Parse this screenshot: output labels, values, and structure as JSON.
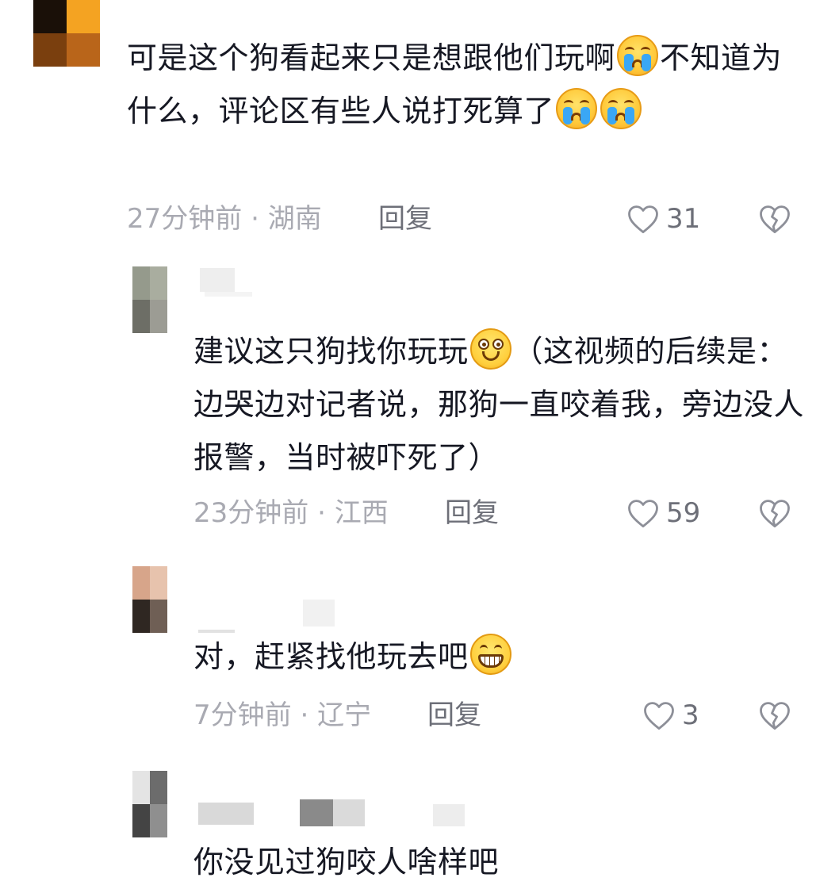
{
  "comments": [
    {
      "segments": [
        {
          "type": "text",
          "value": "可是这个狗看起来只是想跟他们玩啊"
        },
        {
          "type": "emoji",
          "name": "crying-emoji"
        },
        {
          "type": "text",
          "value": "不知道为什么，评论区有些人说打死算了"
        },
        {
          "type": "emoji",
          "name": "crying-emoji"
        },
        {
          "type": "emoji",
          "name": "crying-emoji"
        }
      ],
      "time": "27分钟前",
      "separator": " · ",
      "location": "湖南",
      "reply_label": "回复",
      "like_count": "31",
      "avatar_colors": [
        "#1a1008",
        "#f4a322",
        "#7a3f0e",
        "#b9651a"
      ]
    },
    {
      "segments": [
        {
          "type": "text",
          "value": "建议这只狗找你玩玩"
        },
        {
          "type": "emoji",
          "name": "smile-emoji"
        },
        {
          "type": "text",
          "value": "（这视频的后续是：边哭边对记者说，那狗一直咬着我，旁边没人报警，当时被吓死了）"
        }
      ],
      "time": "23分钟前",
      "separator": " · ",
      "location": "江西",
      "reply_label": "回复",
      "like_count": "59",
      "avatar_colors": [
        "#959a8c",
        "#a9ad9f",
        "#6d6e66",
        "#9c9c94"
      ]
    },
    {
      "segments": [
        {
          "type": "text",
          "value": "对，赶紧找他玩去吧"
        },
        {
          "type": "emoji",
          "name": "grin-emoji"
        }
      ],
      "time": "7分钟前",
      "separator": " · ",
      "location": "辽宁",
      "reply_label": "回复",
      "like_count": "3",
      "avatar_colors": [
        "#d7a58a",
        "#e7c3ad",
        "#2f2722",
        "#6f5f55"
      ]
    },
    {
      "segments": [
        {
          "type": "text",
          "value": "你没见过狗咬人啥样吧"
        }
      ],
      "avatar_colors": [
        "#e4e4e4",
        "#6c6c6c",
        "#444444",
        "#8f8f8f"
      ]
    }
  ],
  "colors": {
    "text": "#161823",
    "meta": "#a9aab2",
    "action": "#6d6f78"
  }
}
